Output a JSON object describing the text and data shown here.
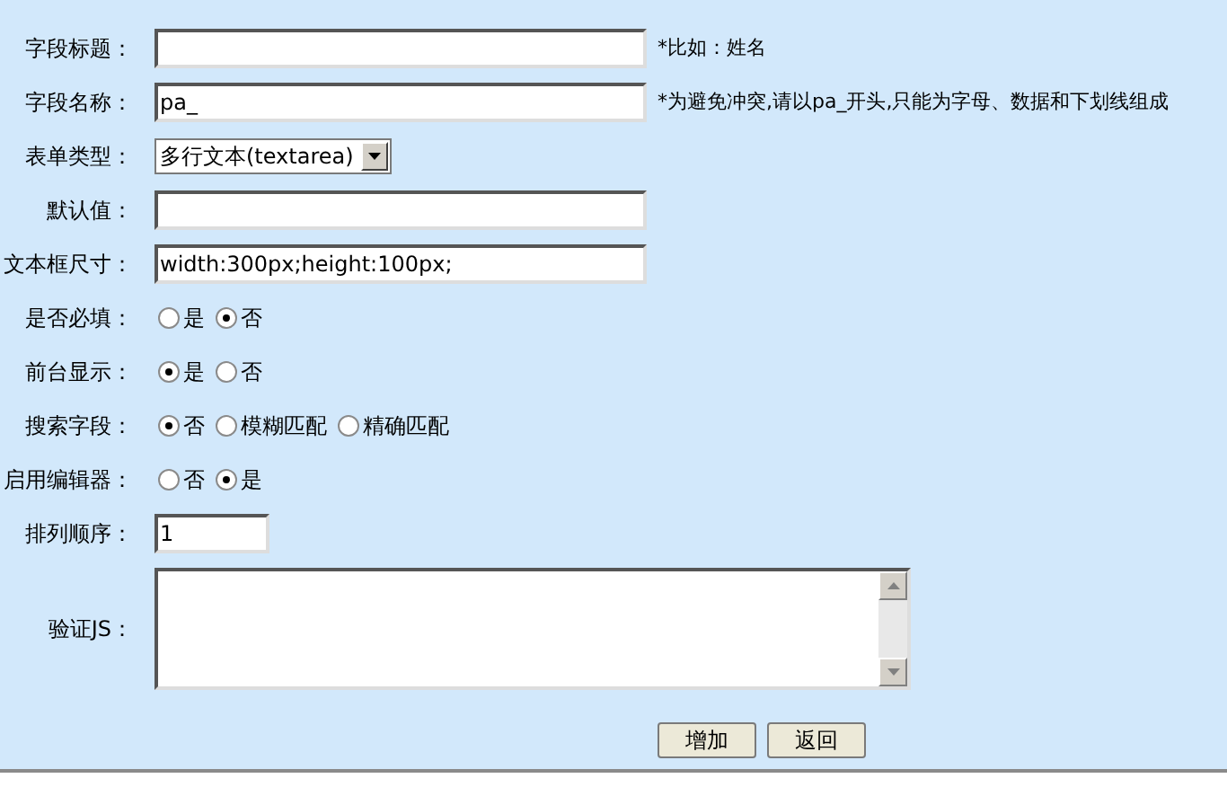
{
  "fields": [
    {
      "kind": "text",
      "label": "字段标题：",
      "note": "*比如：姓名"
    },
    {
      "kind": "text",
      "label": "字段名称：",
      "value": "pa_",
      "note": "*为避免冲突,请以pa_开头,只能为字母、数据和下划线组成"
    },
    {
      "kind": "select",
      "label": "表单类型：",
      "value": "多行文本(textarea)"
    },
    {
      "kind": "text",
      "label": "默认值："
    },
    {
      "kind": "text",
      "label": "文本框尺寸：",
      "value": "width:300px;height:100px;"
    },
    {
      "kind": "radio",
      "label": "是否必填：",
      "options": [
        {
          "label": "是",
          "selected": false
        },
        {
          "label": "否",
          "selected": true
        }
      ]
    },
    {
      "kind": "radio",
      "label": "前台显示：",
      "options": [
        {
          "label": "是",
          "selected": true
        },
        {
          "label": "否",
          "selected": false
        }
      ]
    },
    {
      "kind": "radio",
      "label": "搜索字段：",
      "options": [
        {
          "label": "否",
          "selected": true
        },
        {
          "label": "模糊匹配",
          "selected": false
        },
        {
          "label": "精确匹配",
          "selected": false
        }
      ]
    },
    {
      "kind": "radio",
      "label": "启用编辑器：",
      "options": [
        {
          "label": "否",
          "selected": false
        },
        {
          "label": "是",
          "selected": true
        }
      ]
    },
    {
      "kind": "short_text",
      "label": "排列顺序：",
      "value": "1"
    },
    {
      "kind": "textarea",
      "label": "验证JS："
    }
  ],
  "buttons": [
    "增加",
    "返回"
  ]
}
